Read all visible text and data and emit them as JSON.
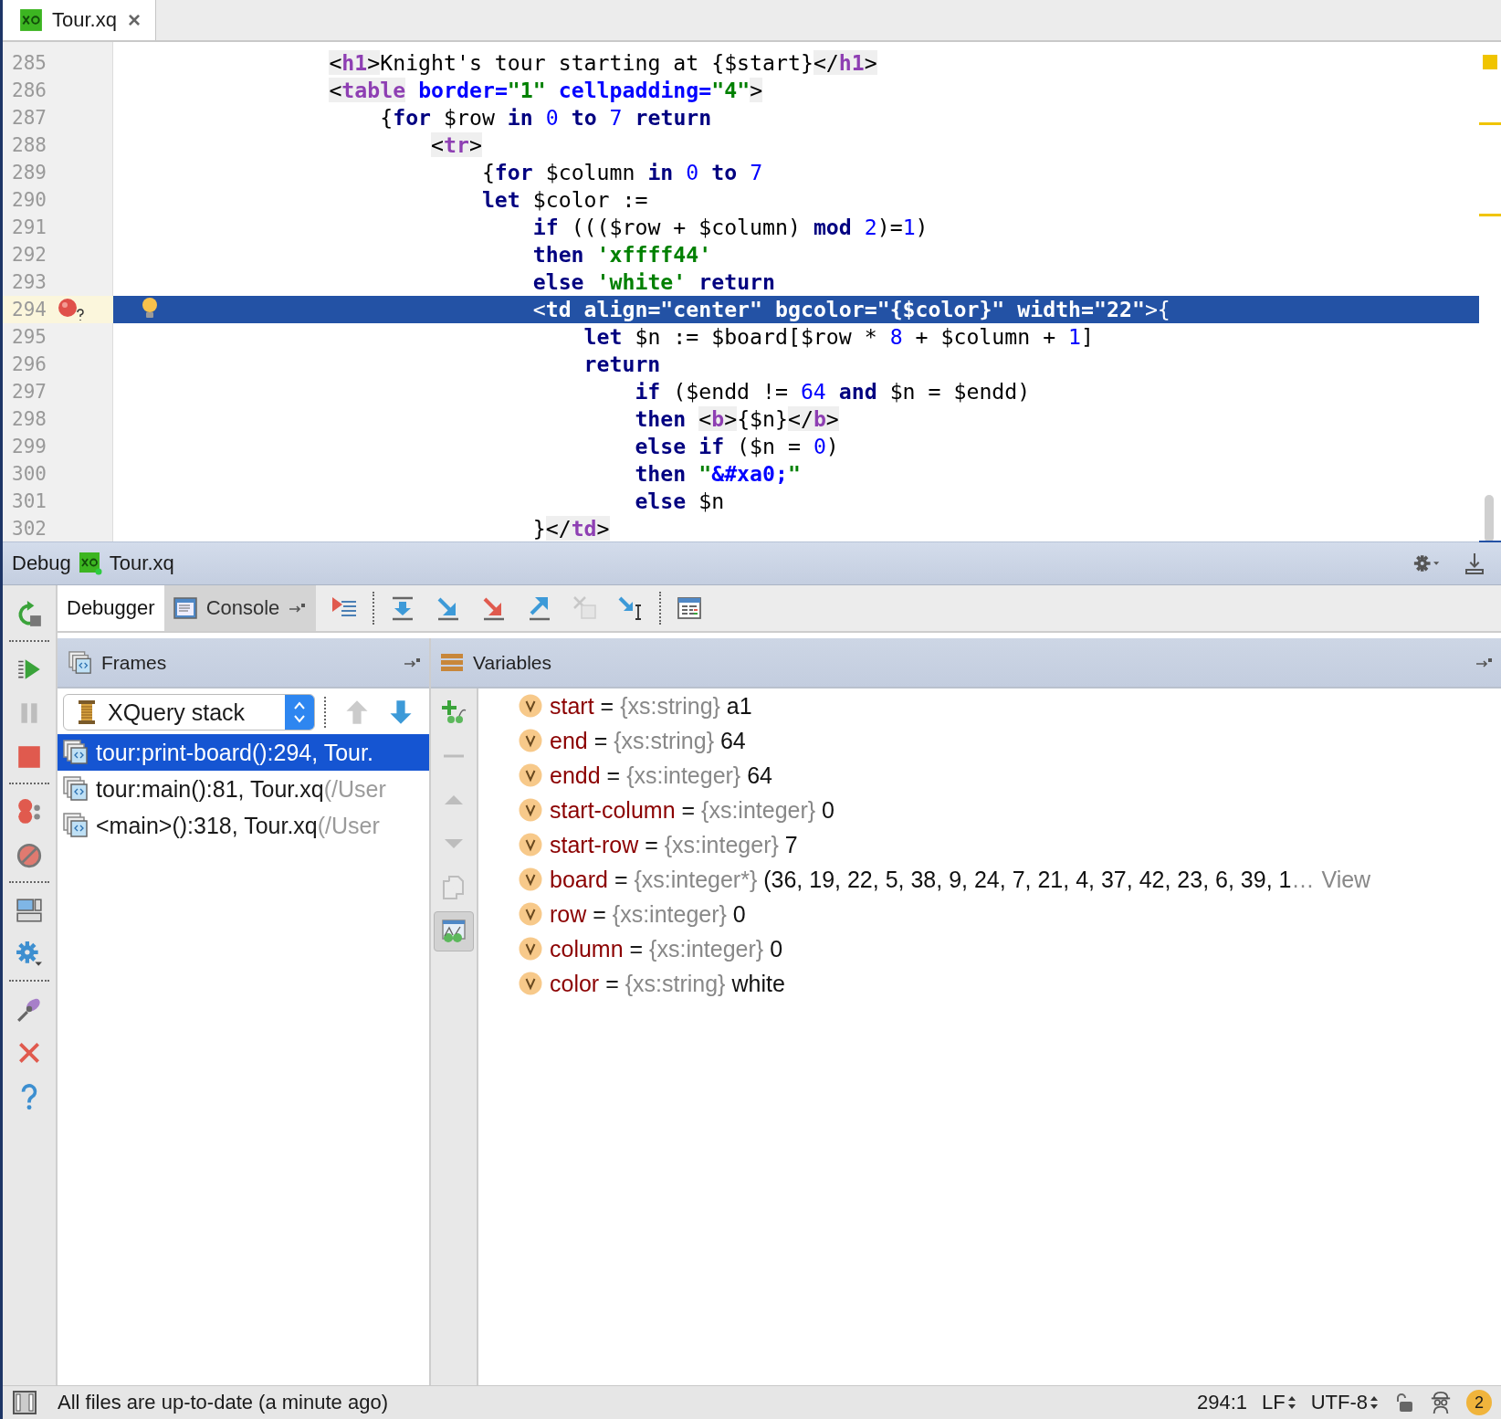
{
  "editor_tabs": [
    {
      "label": "Tour.xq",
      "close": "×",
      "selected": true
    }
  ],
  "editor": {
    "lines": [
      {
        "number": "285",
        "tokens": [
          {
            "text": "                <",
            "kind": "lt"
          },
          {
            "text": "h1",
            "kind": "tag"
          },
          {
            "text": ">",
            "kind": "lt"
          },
          {
            "text": "Knight's tour starting at {$start}",
            "kind": "t"
          },
          {
            "text": "</",
            "kind": "lt"
          },
          {
            "text": "h1",
            "kind": "tag"
          },
          {
            "text": ">",
            "kind": "lt"
          }
        ]
      },
      {
        "number": "286",
        "tokens": [
          {
            "text": "                <",
            "kind": "lt"
          },
          {
            "text": "table",
            "kind": "tag"
          },
          {
            "text": " border=",
            "kind": "a"
          },
          {
            "text": "\"1\"",
            "kind": "s"
          },
          {
            "text": " cellpadding=",
            "kind": "a"
          },
          {
            "text": "\"4\"",
            "kind": "s"
          },
          {
            "text": ">",
            "kind": "lt"
          }
        ]
      },
      {
        "number": "287",
        "tokens": [
          {
            "text": "                    {",
            "kind": "t"
          },
          {
            "text": "for",
            "kind": "k"
          },
          {
            "text": " $row ",
            "kind": "t"
          },
          {
            "text": "in",
            "kind": "k"
          },
          {
            "text": " 0",
            "kind": "n"
          },
          {
            "text": " to",
            "kind": "k"
          },
          {
            "text": " 7",
            "kind": "n"
          },
          {
            "text": " return",
            "kind": "k"
          }
        ]
      },
      {
        "number": "288",
        "tokens": [
          {
            "text": "                        <",
            "kind": "lt"
          },
          {
            "text": "tr",
            "kind": "tag"
          },
          {
            "text": ">",
            "kind": "lt"
          }
        ]
      },
      {
        "number": "289",
        "tokens": [
          {
            "text": "                            {",
            "kind": "t"
          },
          {
            "text": "for",
            "kind": "k"
          },
          {
            "text": " $column ",
            "kind": "t"
          },
          {
            "text": "in",
            "kind": "k"
          },
          {
            "text": " 0",
            "kind": "n"
          },
          {
            "text": " to",
            "kind": "k"
          },
          {
            "text": " 7",
            "kind": "n"
          }
        ]
      },
      {
        "number": "290",
        "tokens": [
          {
            "text": "                            let",
            "kind": "k"
          },
          {
            "text": " $color :=",
            "kind": "t"
          }
        ]
      },
      {
        "number": "291",
        "tokens": [
          {
            "text": "                                if",
            "kind": "k"
          },
          {
            "text": " ((($row + $column) ",
            "kind": "t"
          },
          {
            "text": "mod",
            "kind": "k"
          },
          {
            "text": " 2",
            "kind": "n"
          },
          {
            "text": ")=",
            "kind": "t"
          },
          {
            "text": "1",
            "kind": "n"
          },
          {
            "text": ")",
            "kind": "t"
          }
        ]
      },
      {
        "number": "292",
        "tokens": [
          {
            "text": "                                then",
            "kind": "k"
          },
          {
            "text": " 'xffff44'",
            "kind": "s"
          }
        ]
      },
      {
        "number": "293",
        "tokens": [
          {
            "text": "                                else",
            "kind": "k"
          },
          {
            "text": " 'white'",
            "kind": "s"
          },
          {
            "text": " return",
            "kind": "k"
          }
        ]
      },
      {
        "number": "294",
        "breakpoint": true,
        "hint": true,
        "selected": true,
        "tokens": [
          {
            "text": "                                <",
            "kind": "lt"
          },
          {
            "text": "td",
            "kind": "tag"
          },
          {
            "text": " align=",
            "kind": "a"
          },
          {
            "text": "\"center\"",
            "kind": "s"
          },
          {
            "text": " bgcolor=",
            "kind": "a"
          },
          {
            "text": "\"{$color}\"",
            "kind": "s"
          },
          {
            "text": " width=",
            "kind": "a"
          },
          {
            "text": "\"22\"",
            "kind": "s"
          },
          {
            "text": ">{",
            "kind": "t"
          }
        ]
      },
      {
        "number": "295",
        "tokens": [
          {
            "text": "                                    let",
            "kind": "k"
          },
          {
            "text": " $n := $board[$row * ",
            "kind": "t"
          },
          {
            "text": "8",
            "kind": "n"
          },
          {
            "text": " + $column + ",
            "kind": "t"
          },
          {
            "text": "1",
            "kind": "n"
          },
          {
            "text": "]",
            "kind": "t"
          }
        ]
      },
      {
        "number": "296",
        "tokens": [
          {
            "text": "                                    return",
            "kind": "k"
          }
        ]
      },
      {
        "number": "297",
        "tokens": [
          {
            "text": "                                        if",
            "kind": "k"
          },
          {
            "text": " ($endd != ",
            "kind": "t"
          },
          {
            "text": "64",
            "kind": "n"
          },
          {
            "text": " and",
            "kind": "k"
          },
          {
            "text": " $n = $endd)",
            "kind": "t"
          }
        ]
      },
      {
        "number": "298",
        "tokens": [
          {
            "text": "                                        then",
            "kind": "k"
          },
          {
            "text": " <",
            "kind": "lt"
          },
          {
            "text": "b",
            "kind": "tag"
          },
          {
            "text": ">",
            "kind": "lt"
          },
          {
            "text": "{$n}",
            "kind": "t"
          },
          {
            "text": "</",
            "kind": "lt"
          },
          {
            "text": "b",
            "kind": "tag"
          },
          {
            "text": ">",
            "kind": "lt"
          }
        ]
      },
      {
        "number": "299",
        "tokens": [
          {
            "text": "                                        else",
            "kind": "k"
          },
          {
            "text": " if",
            "kind": "k"
          },
          {
            "text": " ($n = ",
            "kind": "t"
          },
          {
            "text": "0",
            "kind": "n"
          },
          {
            "text": ")",
            "kind": "t"
          }
        ]
      },
      {
        "number": "300",
        "tokens": [
          {
            "text": "                                        then",
            "kind": "k"
          },
          {
            "text": " \"",
            "kind": "s"
          },
          {
            "text": "&#xa0;",
            "kind": "a"
          },
          {
            "text": "\"",
            "kind": "s"
          }
        ]
      },
      {
        "number": "301",
        "tokens": [
          {
            "text": "                                        else",
            "kind": "k"
          },
          {
            "text": " $n",
            "kind": "t"
          }
        ]
      },
      {
        "number": "302",
        "tokens": [
          {
            "text": "                                }",
            "kind": "t"
          },
          {
            "text": "</",
            "kind": "lt"
          },
          {
            "text": "td",
            "kind": "tag"
          },
          {
            "text": ">",
            "kind": "lt"
          }
        ]
      }
    ]
  },
  "debug_panel": {
    "title": "Debug",
    "session": "Tour.xq",
    "left_toolbar": [
      {
        "buttons": [
          {
            "kind": "rerun",
            "disabled": false
          }
        ]
      },
      {
        "buttons": [
          {
            "kind": "resume",
            "disabled": false
          },
          {
            "kind": "pause",
            "disabled": true
          },
          {
            "kind": "stop",
            "disabled": false
          }
        ]
      },
      {
        "buttons": [
          {
            "kind": "breakpoints",
            "disabled": false
          },
          {
            "kind": "mute",
            "disabled": false
          }
        ]
      },
      {
        "buttons": [
          {
            "kind": "layout",
            "disabled": false
          },
          {
            "kind": "settings",
            "disabled": false
          }
        ]
      },
      {
        "buttons": [
          {
            "kind": "pin",
            "disabled": false
          },
          {
            "kind": "close",
            "disabled": false
          },
          {
            "kind": "help",
            "disabled": false
          }
        ]
      }
    ],
    "tabs": [
      {
        "label": "Debugger",
        "selected": true
      },
      {
        "label": "Console",
        "selected": false
      }
    ],
    "toolbar": [
      {
        "buttons": [
          {
            "kind": "execution-point",
            "disabled": false
          }
        ]
      },
      {
        "buttons": [
          {
            "kind": "step-over",
            "disabled": false
          },
          {
            "kind": "step-into",
            "disabled": false
          },
          {
            "kind": "force-step-into",
            "disabled": false
          },
          {
            "kind": "step-out",
            "disabled": false
          },
          {
            "kind": "drop-frame",
            "disabled": true
          },
          {
            "kind": "run-to-cursor",
            "disabled": false
          }
        ]
      },
      {
        "buttons": [
          {
            "kind": "evaluate",
            "disabled": false
          }
        ]
      }
    ],
    "frames": {
      "title": "Frames",
      "stack_selector": "XQuery stack",
      "nav": [
        {
          "kind": "up",
          "disabled": true
        },
        {
          "kind": "down",
          "disabled": false
        }
      ],
      "items": [
        {
          "name": "tour:print-board():294, Tour.",
          "selected": true
        },
        {
          "name": "tour:main():81, Tour.xq",
          "location": "(/User",
          "selected": false
        },
        {
          "name": "<main>():318, Tour.xq",
          "location": "(/User",
          "selected": false
        }
      ]
    },
    "watch_toolbar": [
      {
        "kind": "add",
        "disabled": false
      },
      {
        "kind": "remove",
        "disabled": true
      },
      {
        "kind": "up",
        "disabled": true
      },
      {
        "kind": "down",
        "disabled": true
      },
      {
        "kind": "copy",
        "disabled": true
      },
      {
        "kind": "watches",
        "disabled": false,
        "on": true
      }
    ],
    "variables": {
      "title": "Variables",
      "items": [
        {
          "name": "start",
          "operator": "=",
          "type": "{xs:string}",
          "value": "a1"
        },
        {
          "name": "end",
          "operator": "=",
          "type": "{xs:string}",
          "value": "64"
        },
        {
          "name": "endd",
          "operator": "=",
          "type": "{xs:integer}",
          "value": "64"
        },
        {
          "name": "start-column",
          "operator": "=",
          "type": "{xs:integer}",
          "value": "0"
        },
        {
          "name": "start-row",
          "operator": "=",
          "type": "{xs:integer}",
          "value": "7"
        },
        {
          "name": "board",
          "operator": "=",
          "type": "{xs:integer*}",
          "value": "(36, 19, 22, 5, 38, 9, 24, 7, 21, 4, 37, 42, 23, 6, 39, 1",
          "more": "…",
          "link": "View"
        },
        {
          "name": "row",
          "operator": "=",
          "type": "{xs:integer}",
          "value": "0"
        },
        {
          "name": "column",
          "operator": "=",
          "type": "{xs:integer}",
          "value": "0"
        },
        {
          "name": "color",
          "operator": "=",
          "type": "{xs:string}",
          "value": "white"
        }
      ]
    }
  },
  "status_bar": {
    "message": "All files are up-to-date (a minute ago)",
    "position": "294:1",
    "line_separator": "LF",
    "encoding": "UTF-8",
    "notifications": "2"
  }
}
